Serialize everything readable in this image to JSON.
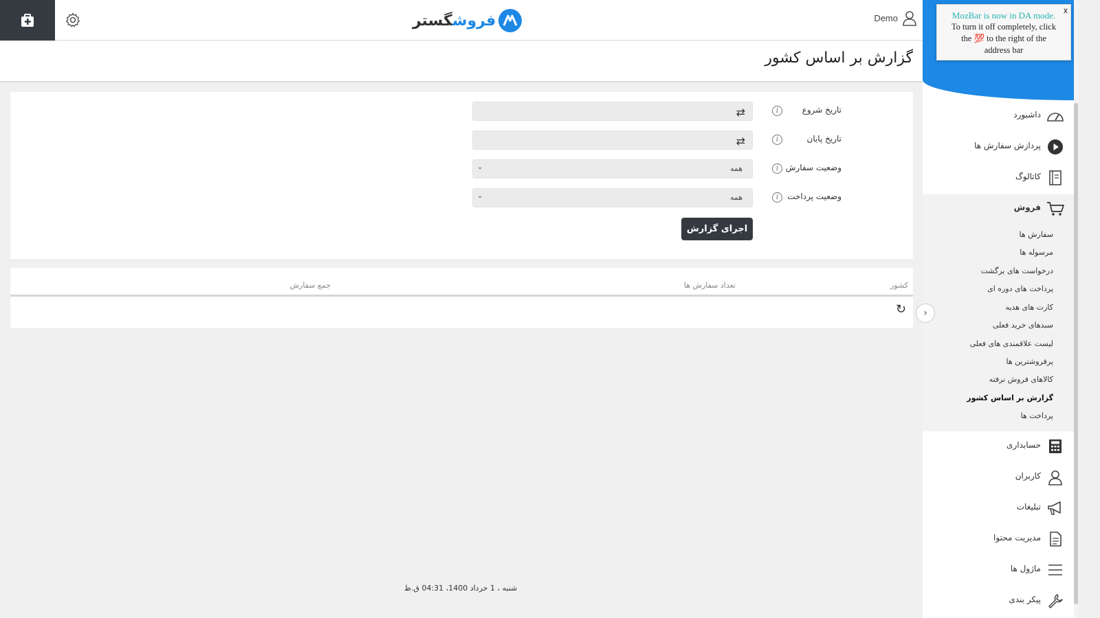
{
  "header": {
    "logo_prefix": "فروش",
    "logo_suffix": "گستر",
    "user_name": "Demo"
  },
  "page": {
    "title": "گزارش بر اساس کشور"
  },
  "filters": {
    "start_date_label": "تاریخ شروع",
    "end_date_label": "تاریخ پایان",
    "order_status_label": "وضعیت سفارش",
    "order_status_value": "همه",
    "payment_status_label": "وضعیت پرداخت",
    "payment_status_value": "همه",
    "run_button": "اجرای گزارش"
  },
  "table": {
    "columns": [
      "کشور",
      "تعداد سفارش ها",
      "جمع سفارش"
    ]
  },
  "footer": {
    "date": "شنبه ، 1 خرداد 1400، 04:31 ق.ظ"
  },
  "sidebar": {
    "items_top": [
      {
        "label": "داشبورد",
        "icon": "dashboard-icon"
      },
      {
        "label": "پردازش سفارش ها",
        "icon": "play-icon"
      },
      {
        "label": "کاتالوگ",
        "icon": "book-icon"
      },
      {
        "label": "فروش",
        "icon": "cart-icon"
      }
    ],
    "sales_sub": [
      "سفارش ها",
      "مرسوله ها",
      "درخواست های برگشت",
      "پرداخت های دوره ای",
      "کارت های هدیه",
      "سبدهای خرید فعلی",
      "لیست علاقمندی های فعلی",
      "پرفروشترین ها",
      "کالاهای فروش نرفته",
      "گزارش بر اساس کشور",
      "پرداخت ها"
    ],
    "items_bottom": [
      {
        "label": "حسابداری",
        "icon": "calculator-icon"
      },
      {
        "label": "کاربران",
        "icon": "user-icon"
      },
      {
        "label": "تبلیغات",
        "icon": "megaphone-icon"
      },
      {
        "label": "مدیریت محتوا",
        "icon": "document-icon"
      },
      {
        "label": "ماژول ها",
        "icon": "list-icon"
      },
      {
        "label": "پیکر بندی",
        "icon": "wrench-icon"
      }
    ]
  },
  "mozbar": {
    "title": "MozBar is now in DA mode.",
    "line1": "To turn it off completely, click",
    "line2": "the 💯 to the right of the",
    "line3": "address bar",
    "close": "x"
  },
  "colors": {
    "accent": "#1e88e5",
    "dark_button": "#343a40",
    "mozbar_title": "#25b3b0"
  }
}
